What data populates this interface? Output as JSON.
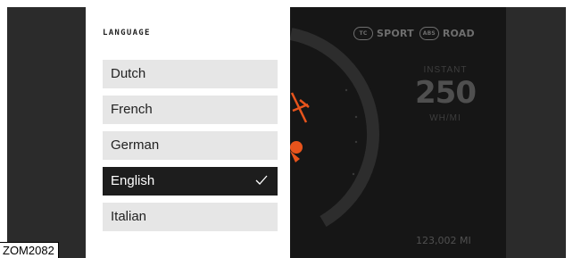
{
  "settings_panel": {
    "title": "LANGUAGE",
    "options": [
      {
        "label": "Dutch",
        "selected": false
      },
      {
        "label": "French",
        "selected": false
      },
      {
        "label": "German",
        "selected": false
      },
      {
        "label": "English",
        "selected": true
      },
      {
        "label": "Italian",
        "selected": false
      }
    ],
    "selected_indicator_icon": "checkmark-icon"
  },
  "dashboard": {
    "modes": [
      {
        "icon": "traction-control-icon",
        "icon_text": "TC",
        "label": "SPORT"
      },
      {
        "icon": "road-mode-icon",
        "icon_text": "ABS",
        "label": "ROAD"
      }
    ],
    "instant_label": "INSTANT",
    "instant_value": "250",
    "instant_unit": "WH/MI",
    "odometer": "123,002 MI"
  },
  "figure_code": "ZOM2082",
  "colors": {
    "screen_background": "#161616",
    "accent_orange": "#e8541c",
    "selected_option": "#1d1d1d",
    "option_background": "#e6e6e6"
  }
}
